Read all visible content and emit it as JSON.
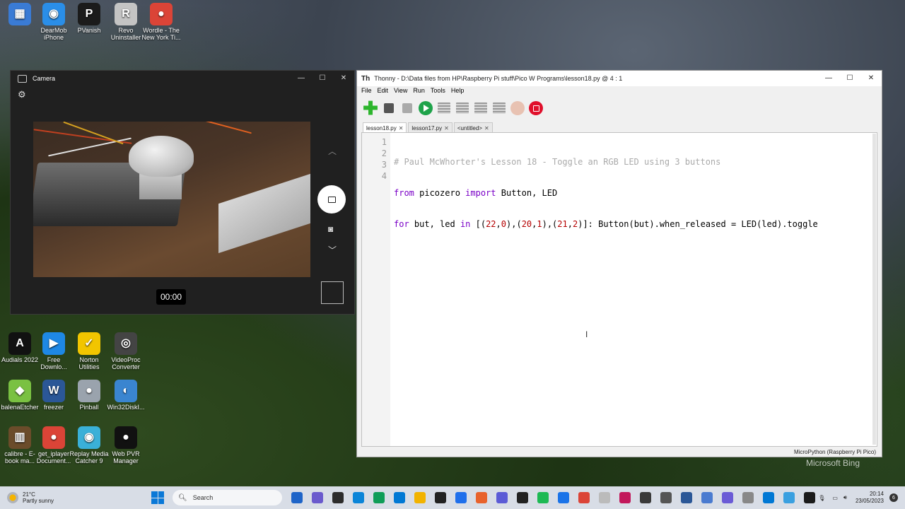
{
  "desktop_icons": [
    {
      "label": "",
      "color": "#3a7bd5",
      "glyph": "▦"
    },
    {
      "label": "DearMob iPhone",
      "color": "#2a8ee8",
      "glyph": "◉"
    },
    {
      "label": "PVanish",
      "color": "#1b1b1b",
      "glyph": "P"
    },
    {
      "label": "Revo Uninstaller",
      "color": "#c4c4c4",
      "glyph": "R"
    },
    {
      "label": "Wordle - The New York Ti...",
      "color": "#db4437",
      "glyph": "●"
    },
    {
      "label": "Audials 2022",
      "color": "#111111",
      "glyph": "A"
    },
    {
      "label": "Free Downlo...",
      "color": "#1e88e5",
      "glyph": "▶"
    },
    {
      "label": "Norton Utilities",
      "color": "#f2c500",
      "glyph": "✓"
    },
    {
      "label": "VideoProc Converter",
      "color": "#444444",
      "glyph": "◎"
    },
    {
      "label": "balenaEtcher",
      "color": "#7ac142",
      "glyph": "◆"
    },
    {
      "label": "freezer",
      "color": "#2b5797",
      "glyph": "W"
    },
    {
      "label": "Pinball",
      "color": "#9aa3ad",
      "glyph": "●"
    },
    {
      "label": "Win32DiskI...",
      "color": "#3a85d0",
      "glyph": "◐"
    },
    {
      "label": "calibre - E-book ma...",
      "color": "#6b4c2a",
      "glyph": "▥"
    },
    {
      "label": "get_iplayer Document...",
      "color": "#db4437",
      "glyph": "●"
    },
    {
      "label": "Replay Media Catcher 9",
      "color": "#3ab0d8",
      "glyph": "◉"
    },
    {
      "label": "Web PVR Manager",
      "color": "#111111",
      "glyph": "●"
    }
  ],
  "camera": {
    "title": "Camera",
    "timer": "00:00",
    "settings_icon": "gear-icon",
    "record_icon": "video-icon",
    "photo_icon": "camera-icon"
  },
  "thonny": {
    "title": "Thonny  -  D:\\Data files from HP\\Raspberry Pi stuff\\Pico W Programs\\lesson18.py  @  4 : 1",
    "menu": [
      "File",
      "Edit",
      "View",
      "Run",
      "Tools",
      "Help"
    ],
    "tabs": [
      {
        "label": "lesson18.py",
        "active": true
      },
      {
        "label": "lesson17.py",
        "active": false
      },
      {
        "label": "<untitled>",
        "active": false
      }
    ],
    "line_numbers": [
      "1",
      "2",
      "3",
      "4"
    ],
    "code": {
      "line1": "# Paul McWhorter's Lesson 18 - Toggle an RGB LED using 3 buttons",
      "line2_kw1": "from",
      "line2_mid": " picozero ",
      "line2_kw2": "import",
      "line2_end": " Button, LED",
      "line3_kw1": "for",
      "line3_a": " but, led ",
      "line3_kw2": "in",
      "line3_b": " [(",
      "n1": "22",
      "c1": ",",
      "n2": "0",
      "line3_c": "),(",
      "n3": "20",
      "c2": ",",
      "n4": "1",
      "line3_d": "),(",
      "n5": "21",
      "c3": ",",
      "n6": "2",
      "line3_e": ")]: Button(but).when_released = LED(led).toggle"
    },
    "status": "MicroPython (Raspberry Pi Pico)"
  },
  "taskbar": {
    "temperature": "21°C",
    "weather": "Partly sunny",
    "search_placeholder": "Search",
    "time": "20:14",
    "date": "23/05/2023",
    "notification_count": "6",
    "app_colors": [
      "#1e64c8",
      "#6a5acd",
      "#2c2c2c",
      "#0a84d8",
      "#0f9d58",
      "#0078d4",
      "#f2b300",
      "#222222",
      "#1f6feb",
      "#e8622c",
      "#5b5bd6",
      "#222222",
      "#1db954",
      "#1a73e8",
      "#db4437",
      "#bbbbbb",
      "#c2185b",
      "#3a3a3a",
      "#555555",
      "#2b5797",
      "#4a7bd0",
      "#6b5bd6",
      "#888888",
      "#0078d4",
      "#3aa0e0",
      "#1b1b1b"
    ]
  },
  "watermark": "Microsoft Bing"
}
